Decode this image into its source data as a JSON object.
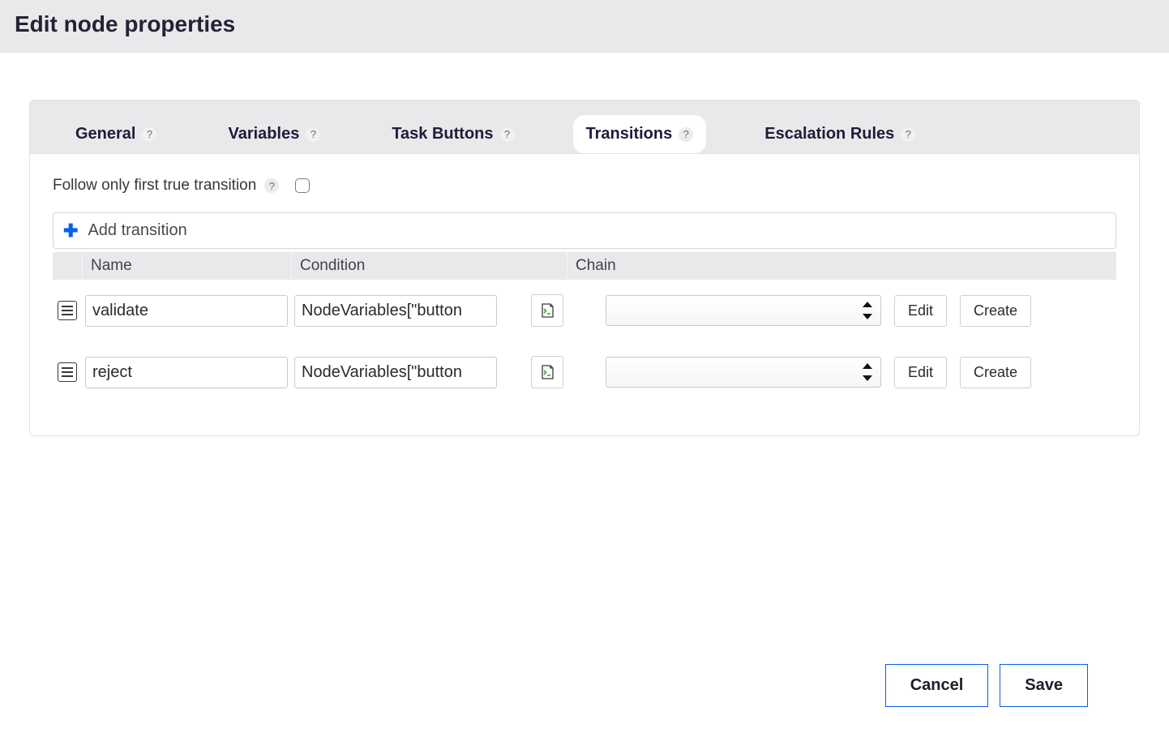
{
  "header": {
    "title": "Edit node properties"
  },
  "tabs": [
    {
      "label": "General",
      "active": false
    },
    {
      "label": "Variables",
      "active": false
    },
    {
      "label": "Task Buttons",
      "active": false
    },
    {
      "label": "Transitions",
      "active": true
    },
    {
      "label": "Escalation Rules",
      "active": false
    }
  ],
  "transitions": {
    "follow_label": "Follow only first true transition",
    "follow_checked": false,
    "add_label": "Add transition",
    "columns": {
      "name": "Name",
      "condition": "Condition",
      "chain": "Chain"
    },
    "rows": [
      {
        "name": "validate",
        "condition": "NodeVariables[\"button",
        "chain_selected": "",
        "edit_label": "Edit",
        "create_label": "Create"
      },
      {
        "name": "reject",
        "condition": "NodeVariables[\"button",
        "chain_selected": "",
        "edit_label": "Edit",
        "create_label": "Create"
      }
    ]
  },
  "footer": {
    "cancel": "Cancel",
    "save": "Save"
  },
  "icons": {
    "help": "?",
    "plus": "✚"
  }
}
